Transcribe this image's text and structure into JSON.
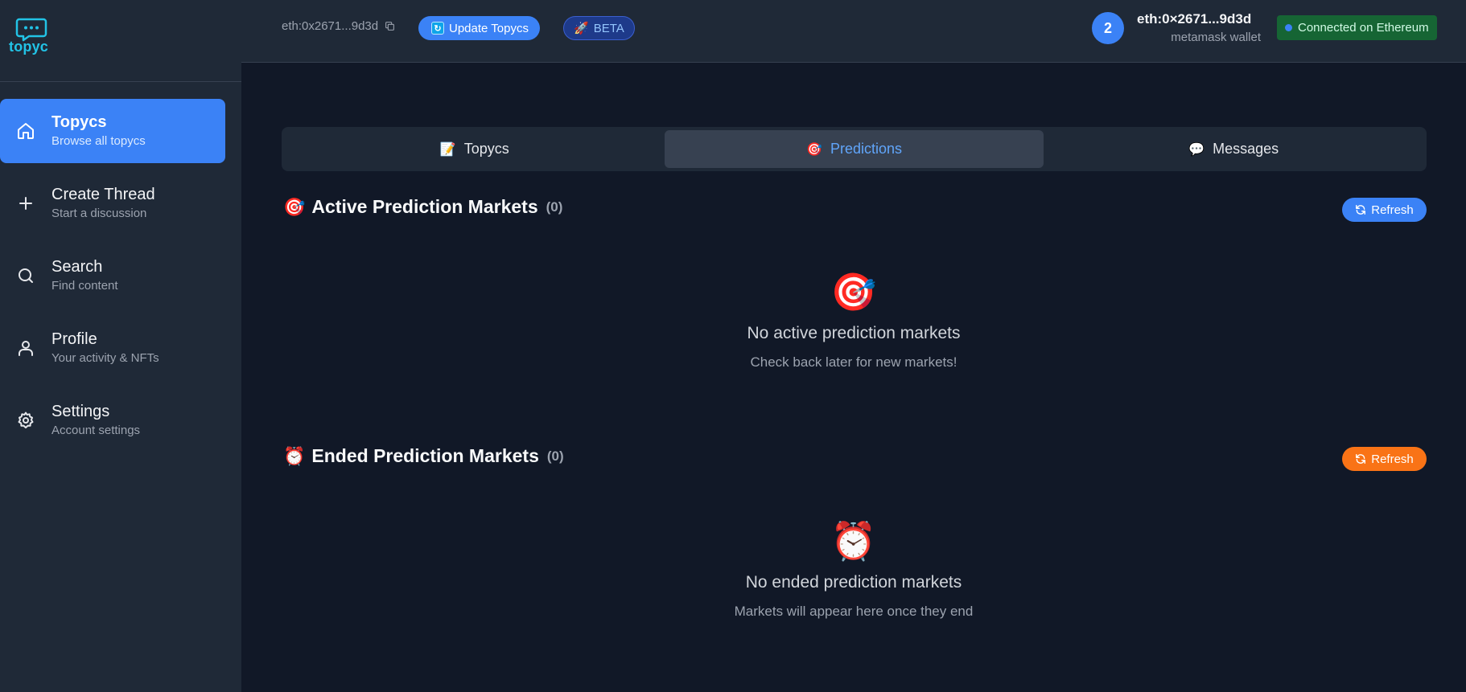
{
  "brand": {
    "name": "topyc",
    "accent": "#22c3e6"
  },
  "sidebar": {
    "items": [
      {
        "icon": "home-icon",
        "title": "Topycs",
        "subtitle": "Browse all topycs",
        "active": true
      },
      {
        "icon": "plus-icon",
        "title": "Create Thread",
        "subtitle": "Start a discussion",
        "active": false
      },
      {
        "icon": "search-icon",
        "title": "Search",
        "subtitle": "Find content",
        "active": false
      },
      {
        "icon": "user-icon",
        "title": "Profile",
        "subtitle": "Your activity & NFTs",
        "active": false
      },
      {
        "icon": "gear-icon",
        "title": "Settings",
        "subtitle": "Account settings",
        "active": false
      }
    ]
  },
  "header": {
    "address": "eth:0x2671...9d3d",
    "update_label": "Update Topycs",
    "beta_label": "BETA",
    "avatar_initial": "2",
    "user_name": "eth:0×2671...9d3d",
    "user_wallet": "metamask wallet",
    "connection_status": "Connected on Ethereum"
  },
  "tabs": [
    {
      "emoji": "📝",
      "label": "Topycs",
      "active": false
    },
    {
      "emoji": "🎯",
      "label": "Predictions",
      "active": true
    },
    {
      "emoji": "💬",
      "label": "Messages",
      "active": false
    }
  ],
  "active_markets": {
    "emoji": "🎯",
    "title": "Active Prediction Markets",
    "count": "(0)",
    "refresh_label": "Refresh",
    "empty_emoji": "🎯",
    "empty_title": "No active prediction markets",
    "empty_subtitle": "Check back later for new markets!"
  },
  "ended_markets": {
    "emoji": "⏰",
    "title": "Ended Prediction Markets",
    "count": "(0)",
    "refresh_label": "Refresh",
    "empty_emoji": "⏰",
    "empty_title": "No ended prediction markets",
    "empty_subtitle": "Markets will appear here once they end"
  },
  "colors": {
    "primary": "#3b82f6",
    "orange": "#f97316",
    "connected_bg": "#166534",
    "sidebar_bg": "#1f2937",
    "main_bg": "#111827"
  }
}
